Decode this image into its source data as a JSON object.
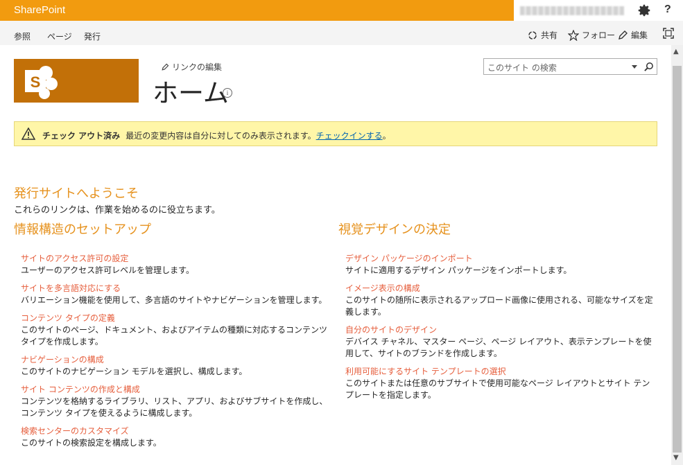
{
  "suite": {
    "brand": "SharePoint",
    "help": "?"
  },
  "ribbon": {
    "tabs": [
      "参照",
      "ページ",
      "発行"
    ],
    "actions": {
      "share": "共有",
      "follow": "フォロー",
      "edit": "編集"
    }
  },
  "header": {
    "edit_links": "リンクの編集",
    "title": "ホーム",
    "info": "i",
    "search_placeholder": "このサイト の検索"
  },
  "banner": {
    "status": "チェック アウト済み",
    "message": "最近の変更内容は自分に対してのみ表示されます。",
    "link": "チェックインする",
    "suffix": "。"
  },
  "welcome": {
    "title": "発行サイトへようこそ",
    "subtitle": "これらのリンクは、作業を始めるのに役立ちます。"
  },
  "left": {
    "heading": "情報構造のセットアップ",
    "items": [
      {
        "link": "サイトのアクセス許可の設定",
        "desc": "ユーザーのアクセス許可レベルを管理します。"
      },
      {
        "link": "サイトを多言語対応にする",
        "desc": "バリエーション機能を使用して、多言語のサイトやナビゲーションを管理します。"
      },
      {
        "link": "コンテンツ タイプの定義",
        "desc": "このサイトのページ、ドキュメント、およびアイテムの種類に対応するコンテンツ タイプを作成します。"
      },
      {
        "link": "ナビゲーションの構成",
        "desc": "このサイトのナビゲーション モデルを選択し、構成します。"
      },
      {
        "link": "サイト コンテンツの作成と構成",
        "desc": "コンテンツを格納するライブラリ、リスト、アプリ、およびサブサイトを作成し、コンテンツ タイプを使えるように構成します。"
      },
      {
        "link": "検索センターのカスタマイズ",
        "desc": "このサイトの検索設定を構成します。"
      }
    ]
  },
  "right": {
    "heading": "視覚デザインの決定",
    "items": [
      {
        "link": "デザイン パッケージのインポート",
        "desc": "サイトに適用するデザイン パッケージをインポートします。"
      },
      {
        "link": "イメージ表示の構成",
        "desc": "このサイトの随所に表示されるアップロード画像に使用される、可能なサイズを定義します。"
      },
      {
        "link": "自分のサイトのデザイン",
        "desc": "デバイス チャネル、マスター ページ、ページ レイアウト、表示テンプレートを使用して、サイトのブランドを作成します。"
      },
      {
        "link": "利用可能にするサイト テンプレートの選択",
        "desc": "このサイトまたは任意のサブサイトで使用可能なページ レイアウトとサイト テンプレートを指定します。"
      }
    ]
  },
  "colors": {
    "brand": "#f29b0f",
    "logo": "#c27008",
    "heading": "#e6921e",
    "link": "#e65e3c",
    "banner": "#fff6a8"
  }
}
